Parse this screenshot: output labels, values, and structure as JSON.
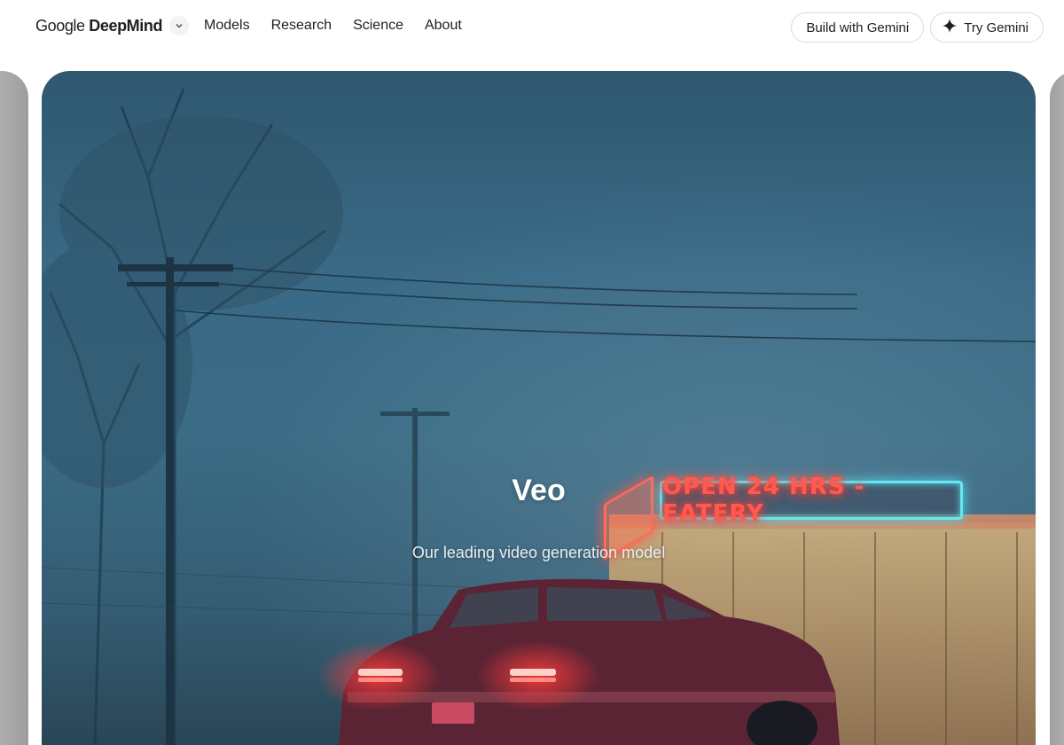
{
  "header": {
    "brand": {
      "google": "Google",
      "deepmind": "DeepMind"
    },
    "nav": [
      {
        "label": "Models"
      },
      {
        "label": "Research"
      },
      {
        "label": "Science"
      },
      {
        "label": "About"
      }
    ],
    "actions": {
      "build_label": "Build with Gemini",
      "try_label": "Try Gemini"
    }
  },
  "hero": {
    "title": "Veo",
    "subtitle": "Our leading video generation model",
    "sign_text": "OPEN 24 HRS - EATERY"
  },
  "icons": {
    "brand_chevron": "chevron-down-icon",
    "try_gemini": "sparkle-icon"
  },
  "colors": {
    "neon_red": "#ff5a50",
    "neon_cyan": "#67e6f0",
    "scene_blue": "#3a6a86"
  }
}
